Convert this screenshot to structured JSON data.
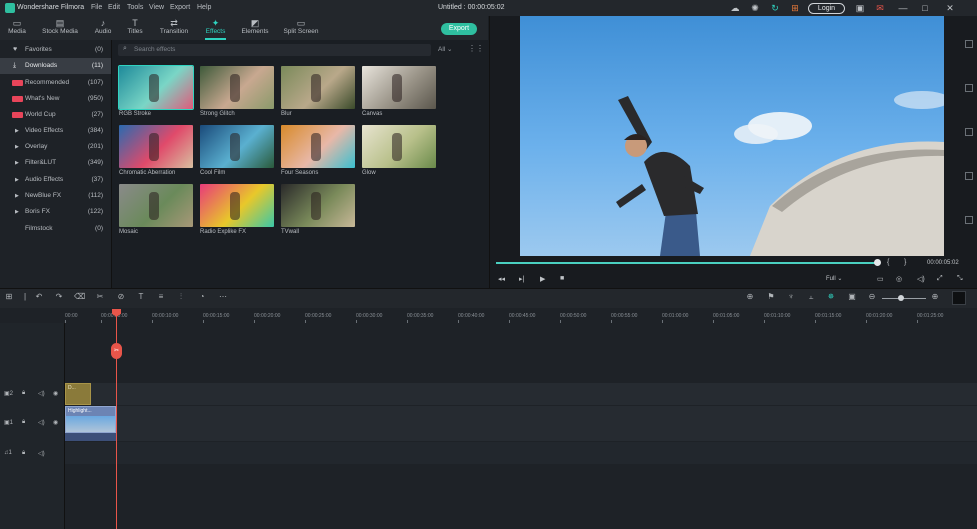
{
  "app": {
    "name": "Wondershare Filmora",
    "menu": [
      "File",
      "Edit",
      "Tools",
      "View",
      "Export",
      "Help"
    ],
    "doc_title": "Untitled : 00:00:05:02",
    "login_label": "Login"
  },
  "tabs": [
    {
      "label": "Media",
      "icon": "folder-icon"
    },
    {
      "label": "Stock Media",
      "icon": "stock-media-icon"
    },
    {
      "label": "Audio",
      "icon": "music-note-icon"
    },
    {
      "label": "Titles",
      "icon": "text-t-icon"
    },
    {
      "label": "Transition",
      "icon": "transition-icon"
    },
    {
      "label": "Effects",
      "icon": "effects-icon"
    },
    {
      "label": "Elements",
      "icon": "elements-icon"
    },
    {
      "label": "Split Screen",
      "icon": "split-screen-icon"
    }
  ],
  "export_label": "Export",
  "sidebar": [
    {
      "label": "Favorites",
      "count": "(0)",
      "icon": "heart-icon"
    },
    {
      "label": "Downloads",
      "count": "(11)",
      "icon": "download-icon"
    },
    {
      "label": "Recommended",
      "count": "(107)",
      "badge": "hot"
    },
    {
      "label": "What's New",
      "count": "(950)",
      "badge": "hot"
    },
    {
      "label": "World Cup",
      "count": "(27)",
      "badge": "hot"
    },
    {
      "label": "Video Effects",
      "count": "(384)"
    },
    {
      "label": "Overlay",
      "count": "(201)"
    },
    {
      "label": "Filter&LUT",
      "count": "(349)"
    },
    {
      "label": "Audio Effects",
      "count": "(37)"
    },
    {
      "label": "NewBlue FX",
      "count": "(112)"
    },
    {
      "label": "Boris FX",
      "count": "(122)"
    },
    {
      "label": "Filmstock",
      "count": "(0)"
    }
  ],
  "search": {
    "placeholder": "Search effects",
    "filter": "All"
  },
  "effects": [
    {
      "label": "RGB Stroke",
      "selected": true,
      "colors": [
        "#1e8a9a",
        "#7ad6c6",
        "#e05a7a"
      ]
    },
    {
      "label": "Strong Glitch",
      "colors": [
        "#3e5a3a",
        "#c8a890",
        "#8a9a6a"
      ]
    },
    {
      "label": "Blur",
      "colors": [
        "#7a8a5a",
        "#b9a88a",
        "#3a4a2a"
      ]
    },
    {
      "label": "Canvas",
      "colors": [
        "#e8e4dc",
        "#9a9488",
        "#5a564c"
      ]
    },
    {
      "label": "Chromatic Aberration",
      "colors": [
        "#2a6ab0",
        "#e04a6a",
        "#d8c0a0"
      ]
    },
    {
      "label": "Cool Film",
      "colors": [
        "#1a4a7a",
        "#5ab0d0",
        "#2a5a3a"
      ]
    },
    {
      "label": "Four Seasons",
      "colors": [
        "#d88a2a",
        "#e8b8a8",
        "#3ac0d0"
      ]
    },
    {
      "label": "Glow",
      "colors": [
        "#e8e4d0",
        "#b8c08a",
        "#6a8a4a"
      ]
    },
    {
      "label": "Mosaic",
      "colors": [
        "#8a8a8a",
        "#6a8a5a",
        "#a89878"
      ]
    },
    {
      "label": "Radio Explike FX",
      "colors": [
        "#e83a7a",
        "#e8c82a",
        "#3ac8a8"
      ]
    },
    {
      "label": "TVwall",
      "colors": [
        "#2a2a2a",
        "#7a8a5a",
        "#c8b898"
      ]
    }
  ],
  "preview": {
    "timecode": "00:00:05:02",
    "quality": "Full",
    "progress": 1.0
  },
  "timeline": {
    "ruler": [
      "00:00",
      "00:00:05:00",
      "00:00:10:00",
      "00:00:15:00",
      "00:00:20:00",
      "00:00:25:00",
      "00:00:30:00",
      "00:00:35:00",
      "00:00:40:00",
      "00:00:45:00",
      "00:00:50:00",
      "00:00:55:00",
      "00:01:00:00",
      "00:01:05:00",
      "00:01:10:00",
      "00:01:15:00",
      "00:01:20:00",
      "00:01:25:00"
    ],
    "tracks": [
      {
        "label": "2",
        "type": "video"
      },
      {
        "label": "1",
        "type": "video"
      },
      {
        "label": "1",
        "type": "audio"
      }
    ],
    "clip_track2_label": "D...",
    "clip_track1_label": "Highlight..."
  },
  "colors": {
    "accent": "#2fd3c0",
    "playhead": "#e8554a",
    "hot_badge": "#e8455a"
  }
}
